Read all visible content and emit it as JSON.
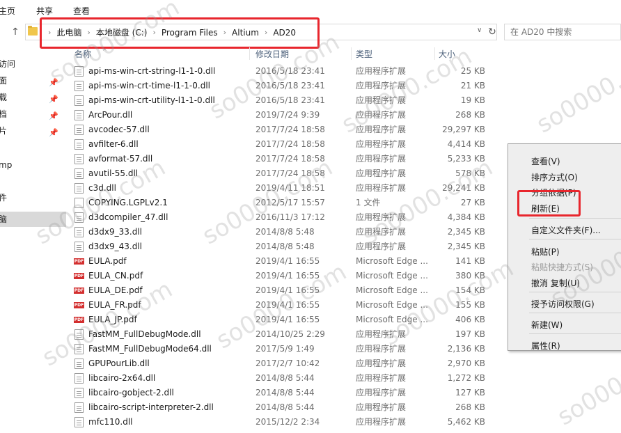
{
  "ribbon": {
    "tabs": [
      "主页",
      "共享",
      "查看"
    ]
  },
  "address": {
    "breadcrumbs": [
      "此电脑",
      "本地磁盘 (C:)",
      "Program Files",
      "Altium",
      "AD20"
    ]
  },
  "search": {
    "placeholder": "在 AD20 中搜索"
  },
  "nav": {
    "items": [
      {
        "label": "访问",
        "pinned": false
      },
      {
        "label": "面",
        "pinned": true
      },
      {
        "label": "载",
        "pinned": true
      },
      {
        "label": "档",
        "pinned": true
      },
      {
        "label": "片",
        "pinned": true
      },
      {
        "label": "mp",
        "pinned": false
      },
      {
        "label": "件",
        "pinned": false
      },
      {
        "label": "脑",
        "pinned": false,
        "selected": true
      }
    ]
  },
  "columns": {
    "name": "名称",
    "date": "修改日期",
    "type": "类型",
    "size": "大小"
  },
  "files": [
    {
      "name": "api-ms-win-crt-string-l1-1-0.dll",
      "date": "2016/5/18 23:41",
      "type": "应用程序扩展",
      "size": "25 KB",
      "icon": "dll"
    },
    {
      "name": "api-ms-win-crt-time-l1-1-0.dll",
      "date": "2016/5/18 23:41",
      "type": "应用程序扩展",
      "size": "21 KB",
      "icon": "dll"
    },
    {
      "name": "api-ms-win-crt-utility-l1-1-0.dll",
      "date": "2016/5/18 23:41",
      "type": "应用程序扩展",
      "size": "19 KB",
      "icon": "dll"
    },
    {
      "name": "ArcPour.dll",
      "date": "2019/7/24 9:39",
      "type": "应用程序扩展",
      "size": "268 KB",
      "icon": "dll"
    },
    {
      "name": "avcodec-57.dll",
      "date": "2017/7/24 18:58",
      "type": "应用程序扩展",
      "size": "29,297 KB",
      "icon": "dll"
    },
    {
      "name": "avfilter-6.dll",
      "date": "2017/7/24 18:58",
      "type": "应用程序扩展",
      "size": "4,414 KB",
      "icon": "dll"
    },
    {
      "name": "avformat-57.dll",
      "date": "2017/7/24 18:58",
      "type": "应用程序扩展",
      "size": "5,233 KB",
      "icon": "dll"
    },
    {
      "name": "avutil-55.dll",
      "date": "2017/7/24 18:58",
      "type": "应用程序扩展",
      "size": "578 KB",
      "icon": "dll"
    },
    {
      "name": "c3d.dll",
      "date": "2019/4/11 18:51",
      "type": "应用程序扩展",
      "size": "29,241 KB",
      "icon": "dll"
    },
    {
      "name": "COPYING.LGPLv2.1",
      "date": "2012/5/17 15:57",
      "type": "1 文件",
      "size": "27 KB",
      "icon": "txt"
    },
    {
      "name": "d3dcompiler_47.dll",
      "date": "2016/11/3 17:12",
      "type": "应用程序扩展",
      "size": "4,384 KB",
      "icon": "dll"
    },
    {
      "name": "d3dx9_33.dll",
      "date": "2014/8/8 5:48",
      "type": "应用程序扩展",
      "size": "2,345 KB",
      "icon": "dll"
    },
    {
      "name": "d3dx9_43.dll",
      "date": "2014/8/8 5:48",
      "type": "应用程序扩展",
      "size": "2,345 KB",
      "icon": "dll"
    },
    {
      "name": "EULA.pdf",
      "date": "2019/4/1 16:55",
      "type": "Microsoft Edge ...",
      "size": "141 KB",
      "icon": "pdf"
    },
    {
      "name": "EULA_CN.pdf",
      "date": "2019/4/1 16:55",
      "type": "Microsoft Edge ...",
      "size": "380 KB",
      "icon": "pdf"
    },
    {
      "name": "EULA_DE.pdf",
      "date": "2019/4/1 16:55",
      "type": "Microsoft Edge ...",
      "size": "154 KB",
      "icon": "pdf"
    },
    {
      "name": "EULA_FR.pdf",
      "date": "2019/4/1 16:55",
      "type": "Microsoft Edge ...",
      "size": "155 KB",
      "icon": "pdf"
    },
    {
      "name": "EULA_JP.pdf",
      "date": "2019/4/1 16:55",
      "type": "Microsoft Edge ...",
      "size": "406 KB",
      "icon": "pdf"
    },
    {
      "name": "FastMM_FullDebugMode.dll",
      "date": "2014/10/25 2:29",
      "type": "应用程序扩展",
      "size": "197 KB",
      "icon": "dll"
    },
    {
      "name": "FastMM_FullDebugMode64.dll",
      "date": "2017/5/9 1:49",
      "type": "应用程序扩展",
      "size": "2,136 KB",
      "icon": "dll"
    },
    {
      "name": "GPUPourLib.dll",
      "date": "2017/2/7 10:42",
      "type": "应用程序扩展",
      "size": "2,970 KB",
      "icon": "dll"
    },
    {
      "name": "libcairo-2x64.dll",
      "date": "2014/8/8 5:44",
      "type": "应用程序扩展",
      "size": "1,272 KB",
      "icon": "dll"
    },
    {
      "name": "libcairo-gobject-2.dll",
      "date": "2014/8/8 5:44",
      "type": "应用程序扩展",
      "size": "127 KB",
      "icon": "dll"
    },
    {
      "name": "libcairo-script-interpreter-2.dll",
      "date": "2014/8/8 5:44",
      "type": "应用程序扩展",
      "size": "268 KB",
      "icon": "dll"
    },
    {
      "name": "mfc110.dll",
      "date": "2015/12/2 2:34",
      "type": "应用程序扩展",
      "size": "5,462 KB",
      "icon": "dll"
    }
  ],
  "context_menu": {
    "items": [
      {
        "label": "查看(V)",
        "disabled": false,
        "group": 0
      },
      {
        "label": "排序方式(O)",
        "disabled": false,
        "group": 0
      },
      {
        "label": "分组依据(P)",
        "disabled": false,
        "group": 0
      },
      {
        "label": "刷新(E)",
        "disabled": false,
        "group": 0,
        "highlighted": true
      },
      {
        "label": "自定义文件夹(F)...",
        "disabled": false,
        "group": 1
      },
      {
        "label": "粘贴(P)",
        "disabled": false,
        "group": 2
      },
      {
        "label": "粘贴快捷方式(S)",
        "disabled": true,
        "group": 2
      },
      {
        "label": "撤消 复制(U)",
        "disabled": false,
        "group": 2
      },
      {
        "label": "授予访问权限(G)",
        "disabled": false,
        "group": 3
      },
      {
        "label": "新建(W)",
        "disabled": false,
        "group": 4
      },
      {
        "label": "属性(R)",
        "disabled": false,
        "group": 5
      }
    ]
  },
  "watermark": {
    "text": "so0000.com"
  },
  "colors": {
    "highlight_box": "#e8262d",
    "selected_nav": "#d9d9d9",
    "pdf_icon": "#d32f2f"
  },
  "icons": [
    "up-arrow-icon",
    "folder-icon",
    "refresh-icon",
    "pin-icon",
    "dll-file-icon",
    "pdf-file-icon",
    "text-file-icon"
  ]
}
